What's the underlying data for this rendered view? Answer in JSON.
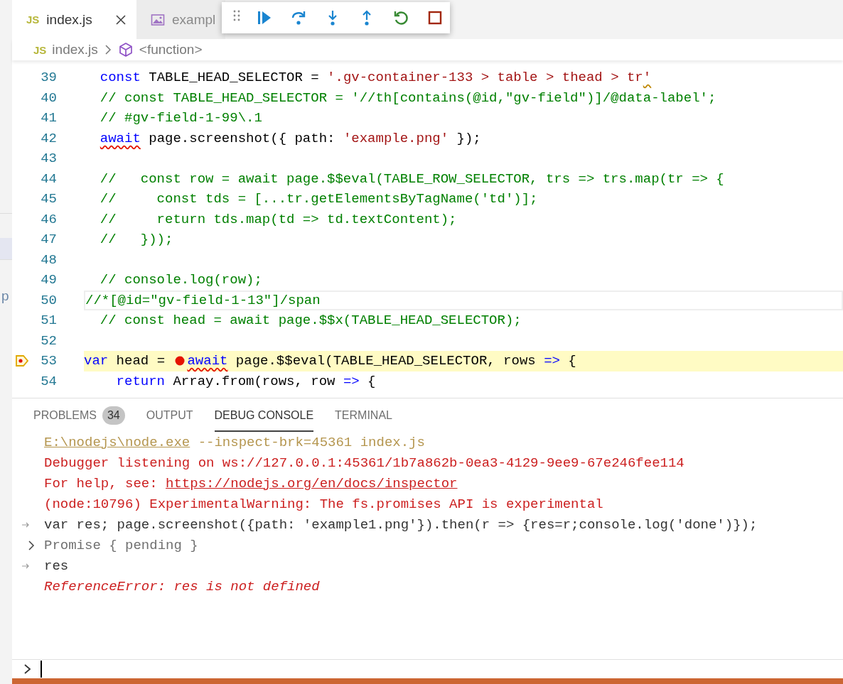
{
  "sidebar": {
    "items": [
      {
        "selected": true
      },
      {
        "label": "p",
        "selected": false
      }
    ]
  },
  "tabs": [
    {
      "label": "index.js",
      "kind": "script",
      "file_icon": "JS",
      "selected": true,
      "closable": true
    },
    {
      "label": "exampl",
      "kind": "image",
      "selected": false
    }
  ],
  "debug_toolbar": {
    "buttons": [
      {
        "kind": "grip"
      },
      {
        "kind": "continue"
      },
      {
        "kind": "step-over"
      },
      {
        "kind": "step-into"
      },
      {
        "kind": "step-out"
      },
      {
        "kind": "restart"
      },
      {
        "kind": "stop"
      }
    ]
  },
  "breadcrumbs": [
    {
      "label": "index.js",
      "kind": "file",
      "file_icon": "JS"
    },
    {
      "label": "<function>",
      "kind": "symbol"
    }
  ],
  "editor": {
    "lines": [
      {
        "number": "39",
        "tokens": [
          {
            "t": "  const",
            "kind": "keyword"
          },
          {
            "t": " TABLE_HEAD_SELECTOR = ",
            "kind": "text"
          },
          {
            "t": "'.gv-container-133 > table > thead > tr",
            "kind": "string"
          },
          {
            "t": "'",
            "kind": "string",
            "warning": true
          }
        ]
      },
      {
        "number": "40",
        "tokens": [
          {
            "t": "  // const TABLE_HEAD_SELECTOR = '//th[contains(@id,\"gv-field\")]/@data-label';",
            "kind": "comment"
          }
        ]
      },
      {
        "number": "41",
        "tokens": [
          {
            "t": "  // #gv-field-1-99\\.1",
            "kind": "comment"
          }
        ]
      },
      {
        "number": "42",
        "tokens": [
          {
            "t": "  await",
            "kind": "keyword",
            "error": true
          },
          {
            "t": " page.screenshot({ path: ",
            "kind": "text"
          },
          {
            "t": "'example.png'",
            "kind": "string"
          },
          {
            "t": " });",
            "kind": "text"
          }
        ]
      },
      {
        "number": "43"
      },
      {
        "number": "44",
        "tokens": [
          {
            "t": "  //   const row = await page.$$eval(TABLE_ROW_SELECTOR, trs => trs.map(tr => {",
            "kind": "comment"
          }
        ]
      },
      {
        "number": "45",
        "tokens": [
          {
            "t": "  //     const tds = [...tr.getElementsByTagName('td')];",
            "kind": "comment"
          }
        ]
      },
      {
        "number": "46",
        "tokens": [
          {
            "t": "  //     return tds.map(td => td.textContent);",
            "kind": "comment"
          }
        ]
      },
      {
        "number": "47",
        "tokens": [
          {
            "t": "  //   }));",
            "kind": "comment"
          }
        ]
      },
      {
        "number": "48"
      },
      {
        "number": "49",
        "tokens": [
          {
            "t": "  // console.log(row);",
            "kind": "comment"
          }
        ]
      },
      {
        "number": "50",
        "cursor": true,
        "tokens": [
          {
            "t": "//*[@id=\"gv-field-1-13\"]/span",
            "kind": "comment"
          }
        ]
      },
      {
        "number": "51",
        "tokens": [
          {
            "t": "  // const head = await page.$$x(TABLE_HEAD_SELECTOR);",
            "kind": "comment"
          }
        ]
      },
      {
        "number": "52"
      },
      {
        "number": "53",
        "paused": true,
        "tokens": [
          {
            "t": "var",
            "kind": "keyword"
          },
          {
            "t": " head = ",
            "kind": "text"
          },
          {
            "kind": "breakpoint"
          },
          {
            "t": "await",
            "kind": "keyword",
            "error": true
          },
          {
            "t": " page.$$eval(TABLE_HEAD_SELECTOR, rows ",
            "kind": "text"
          },
          {
            "t": "=>",
            "kind": "keyword"
          },
          {
            "t": " {",
            "kind": "text"
          }
        ]
      },
      {
        "number": "54",
        "tokens": [
          {
            "t": "    return",
            "kind": "keyword"
          },
          {
            "t": " Array.from(rows, row ",
            "kind": "text"
          },
          {
            "t": "=>",
            "kind": "keyword"
          },
          {
            "t": " {",
            "kind": "text"
          }
        ]
      }
    ]
  },
  "panel": {
    "tabs": [
      {
        "label": "PROBLEMS",
        "badge": "34",
        "selected": false
      },
      {
        "label": "OUTPUT",
        "selected": false
      },
      {
        "label": "DEBUG CONSOLE",
        "selected": true
      },
      {
        "label": "TERMINAL",
        "selected": false
      }
    ],
    "console": [
      {
        "kind": "command",
        "segments": [
          {
            "t": "E:\\nodejs\\node.exe",
            "link": true
          },
          {
            "t": " --inspect-brk=45361 index.js"
          }
        ]
      },
      {
        "kind": "error",
        "segments": [
          {
            "t": "Debugger listening on ws://127.0.0.1:45361/1b7a862b-0ea3-4129-9ee9-67e246fee114"
          }
        ]
      },
      {
        "kind": "error",
        "segments": [
          {
            "t": "For help, see: "
          },
          {
            "t": "https://nodejs.org/en/docs/inspector",
            "link": true
          }
        ]
      },
      {
        "kind": "error",
        "segments": [
          {
            "t": "(node:10796) ExperimentalWarning: The fs.promises API is experimental"
          }
        ]
      },
      {
        "kind": "input",
        "segments": [
          {
            "t": "var res; page.screenshot({path: 'example1.png'}).then(r => {res=r;console.log('done')});"
          }
        ]
      },
      {
        "kind": "result",
        "expanded": false,
        "segments": [
          {
            "t": "Promise { pending }"
          }
        ]
      },
      {
        "kind": "input",
        "segments": [
          {
            "t": "res"
          }
        ]
      },
      {
        "kind": "exception",
        "segments": [
          {
            "t": "ReferenceError: res is not defined"
          }
        ]
      }
    ]
  },
  "status_bar": {
    "debugging": true
  }
}
